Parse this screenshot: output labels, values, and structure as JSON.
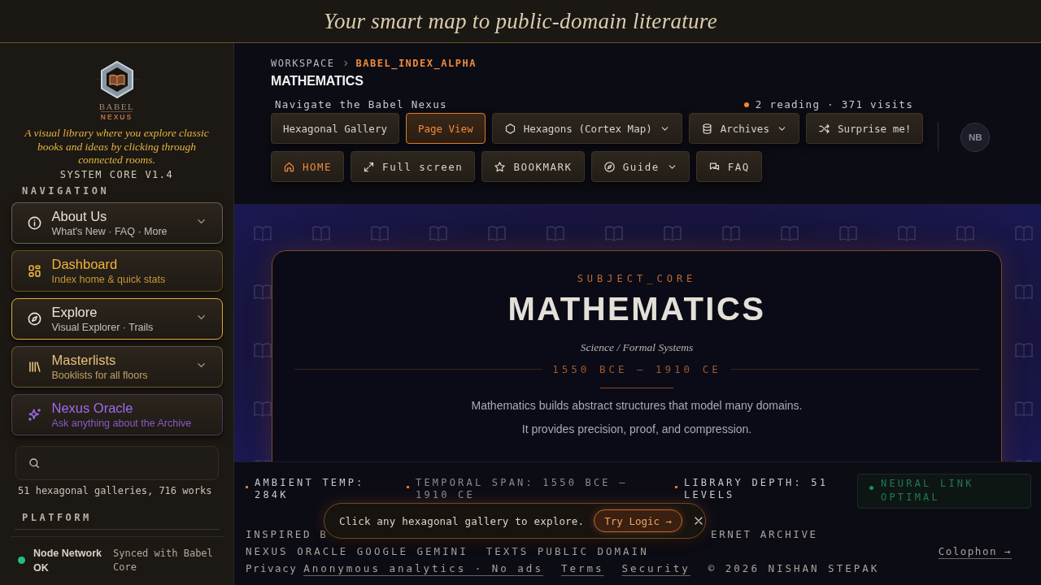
{
  "header": {
    "tagline": "Your smart map to public-domain literature"
  },
  "sidebar": {
    "logo": {
      "line1": "BABEL",
      "line2": "NEXUS"
    },
    "description": "A visual library where you explore classic books and ideas by clicking through connected rooms.",
    "version": "SYSTEM CORE V1.4",
    "nav_heading": "NAVIGATION",
    "nav_items": [
      {
        "kind": "info",
        "title": "About Us",
        "subtitle": "What's New · FAQ · More",
        "expandable": true,
        "selected": false,
        "color": "#e6e0d6"
      },
      {
        "kind": "grid",
        "title": "Dashboard",
        "subtitle": "Index home & quick stats",
        "expandable": false,
        "selected": false,
        "color": "#f0b43c"
      },
      {
        "kind": "compass",
        "title": "Explore",
        "subtitle": "Visual Explorer · Trails",
        "expandable": true,
        "selected": true,
        "color": "#ece6da"
      },
      {
        "kind": "library",
        "title": "Masterlists",
        "subtitle": "Booklists for all floors",
        "expandable": true,
        "selected": false,
        "color": "#e8c078"
      },
      {
        "kind": "sparkle",
        "title": "Nexus Oracle",
        "subtitle": "Ask anything about the Archive",
        "expandable": false,
        "selected": false,
        "color": "#9b6cf0"
      }
    ],
    "count": "51 hexagonal galleries, 716 works",
    "platform_heading": "PLATFORM",
    "status": {
      "label": "Node Network OK",
      "detail": "Synced with Babel Core",
      "ok": true
    }
  },
  "breadcrumb": [
    {
      "label": "WORKSPACE",
      "current": false
    },
    {
      "label": "BABEL_INDEX_ALPHA",
      "current": true
    }
  ],
  "page_title": "MATHEMATICS",
  "nav_caption": "Navigate the Babel Nexus",
  "presence": "2 reading · 371 visits",
  "toolbar_row1": [
    {
      "kind": "plain",
      "label": "Hexagonal Gallery",
      "selected": false,
      "dropdown": false
    },
    {
      "kind": "plain",
      "label": "Page View",
      "selected": true,
      "dropdown": false
    },
    {
      "kind": "hexagon",
      "label": "Hexagons (Cortex Map)",
      "selected": false,
      "dropdown": true
    },
    {
      "kind": "database",
      "label": "Archives",
      "selected": false,
      "dropdown": true
    },
    {
      "kind": "shuffle",
      "label": "Surprise me!",
      "selected": false,
      "dropdown": false
    }
  ],
  "toolbar_row2": [
    {
      "kind": "home",
      "label": "HOME",
      "selected": true,
      "dropdown": false
    },
    {
      "kind": "expand",
      "label": "Full screen",
      "selected": false,
      "dropdown": false
    },
    {
      "kind": "star",
      "label": "BOOKMARK",
      "selected": false,
      "dropdown": false
    },
    {
      "kind": "compass",
      "label": "Guide",
      "selected": false,
      "dropdown": true
    },
    {
      "kind": "chat",
      "label": "FAQ",
      "selected": false,
      "dropdown": false
    }
  ],
  "avatar": "NB",
  "hero": {
    "eyebrow": "SUBJECT_CORE",
    "title": "MATHEMATICS",
    "subtitle": "Science / Formal Systems",
    "era": "1550 BCE — 1910 CE",
    "paragraphs": [
      "Mathematics builds abstract structures that model many domains.",
      "It provides precision, proof, and compression."
    ]
  },
  "stats": [
    {
      "kind": "stat",
      "label": "AMBIENT TEMP: 284K"
    },
    {
      "kind": "stat",
      "label": "TEMPORAL SPAN: 1550 BCE — 1910 CE"
    },
    {
      "kind": "stat",
      "label": "LIBRARY DEPTH: 51 LEVELS"
    },
    {
      "kind": "status",
      "label": "NEURAL LINK OPTIMAL"
    }
  ],
  "toast": {
    "message": "Click any hexagonal gallery to explore.",
    "action": "Try Logic →"
  },
  "footer": {
    "credits_left": "INSPIRED B",
    "credits_right": "ERNET ARCHIVE",
    "oracle": "NEXUS ORACLE GOOGLE GEMINI",
    "texts": "TEXTS PUBLIC DOMAIN",
    "colophon": "Colophon →",
    "privacy_label": "Privacy",
    "links": [
      "Anonymous analytics · No ads",
      "Terms",
      "Security"
    ],
    "copyright": "© 2026 NISHAN STEPAK"
  }
}
